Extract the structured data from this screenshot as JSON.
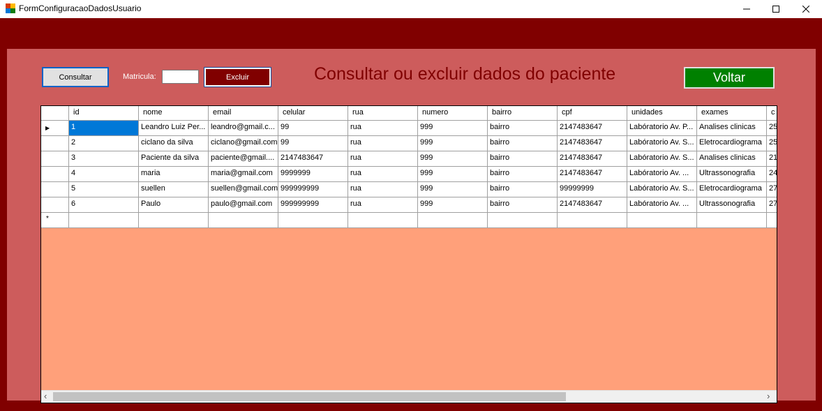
{
  "window": {
    "title": "FormConfiguracaoDadosUsuario",
    "minimize_glyph": "—",
    "maximize_glyph": "☐",
    "close_glyph": "✕"
  },
  "toolbar": {
    "consultar_label": "Consultar",
    "matricula_label": "Matricula:",
    "matricula_value": "",
    "excluir_label": "Excluir",
    "heading": "Consultar ou excluir dados do paciente",
    "voltar_label": "Voltar"
  },
  "grid": {
    "columns": [
      "id",
      "nome",
      "email",
      "celular",
      "rua",
      "numero",
      "bairro",
      "cpf",
      "unidades",
      "exames",
      "c"
    ],
    "rows": [
      [
        "1",
        "Leandro Luiz Per...",
        "leandro@gmail.c...",
        "99",
        "rua",
        "999",
        "bairro",
        "2147483647",
        "Labóratorio Av. P...",
        "Analises clinicas",
        "25"
      ],
      [
        "2",
        "ciclano da silva",
        "ciclano@gmail.com",
        "99",
        "rua",
        "999",
        "bairro",
        "2147483647",
        "Labóratorio Av. S...",
        "Eletrocardiograma",
        "25"
      ],
      [
        "3",
        "Paciente da silva",
        "paciente@gmail....",
        "2147483647",
        "rua",
        "999",
        "bairro",
        "2147483647",
        "Labóratorio Av. S...",
        "Analises clinicas",
        "21"
      ],
      [
        "4",
        "maria",
        "maria@gmail.com",
        "9999999",
        "rua",
        "999",
        "bairro",
        "2147483647",
        "Labóratorio Av. ...",
        "Ultrassonografia",
        "24"
      ],
      [
        "5",
        "suellen",
        "suellen@gmail.com",
        "999999999",
        "rua",
        "999",
        "bairro",
        "99999999",
        "Labóratorio Av. S...",
        "Eletrocardiograma",
        "27"
      ],
      [
        "6",
        "Paulo",
        "paulo@gmail.com",
        "999999999",
        "rua",
        "999",
        "bairro",
        "2147483647",
        "Labóratorio Av. ...",
        "Ultrassonografia",
        "27"
      ]
    ],
    "current_row_glyph": "▶",
    "new_row_glyph": "*",
    "scroll_left_glyph": "‹",
    "scroll_right_glyph": "›"
  },
  "colors": {
    "form_bg": "#800000",
    "panel_bg": "#cd5c5c",
    "grid_bg": "#ffa07a",
    "heading": "#800000",
    "voltar_bg": "#008000"
  }
}
